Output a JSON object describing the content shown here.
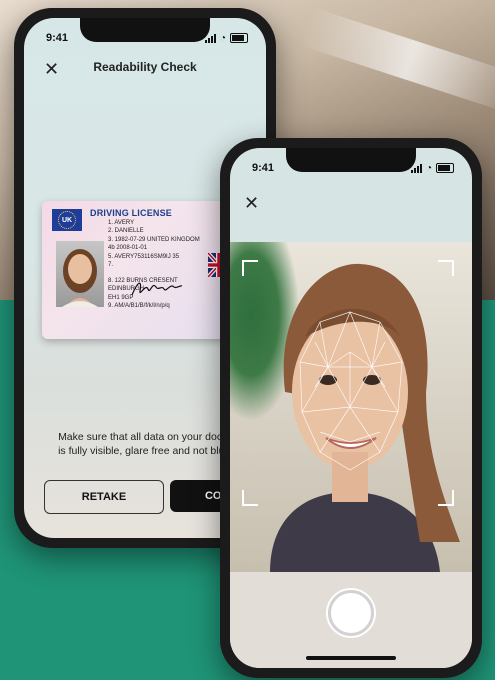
{
  "phone1": {
    "time": "9:41",
    "title": "Readability Check",
    "instruction_line1": "Make sure that all data on your docu",
    "instruction_line2": "is fully visible, glare free and not blur",
    "retake_label": "RETAKE",
    "continue_label": "CONTINU",
    "license": {
      "title": "DRIVING LICENSE",
      "country_code": "UK",
      "fields": [
        "1.   AVERY",
        "2.   DANIELLE",
        "3.   1982-07-29 UNITED KINGDOM",
        "4b  2008-01-01",
        "5.   AVERY753116SM9IJ 35",
        "7.",
        "8.   122 BURNS CRESENT",
        "      EDINBURGH",
        "      EH1 9GP",
        "9.   AM/A/B1/B/f/k/l/n/p/q"
      ]
    }
  },
  "phone2": {
    "time": "9:41"
  },
  "colors": {
    "background_green": "#1f9477",
    "license_title_blue": "#1b3f8e"
  }
}
